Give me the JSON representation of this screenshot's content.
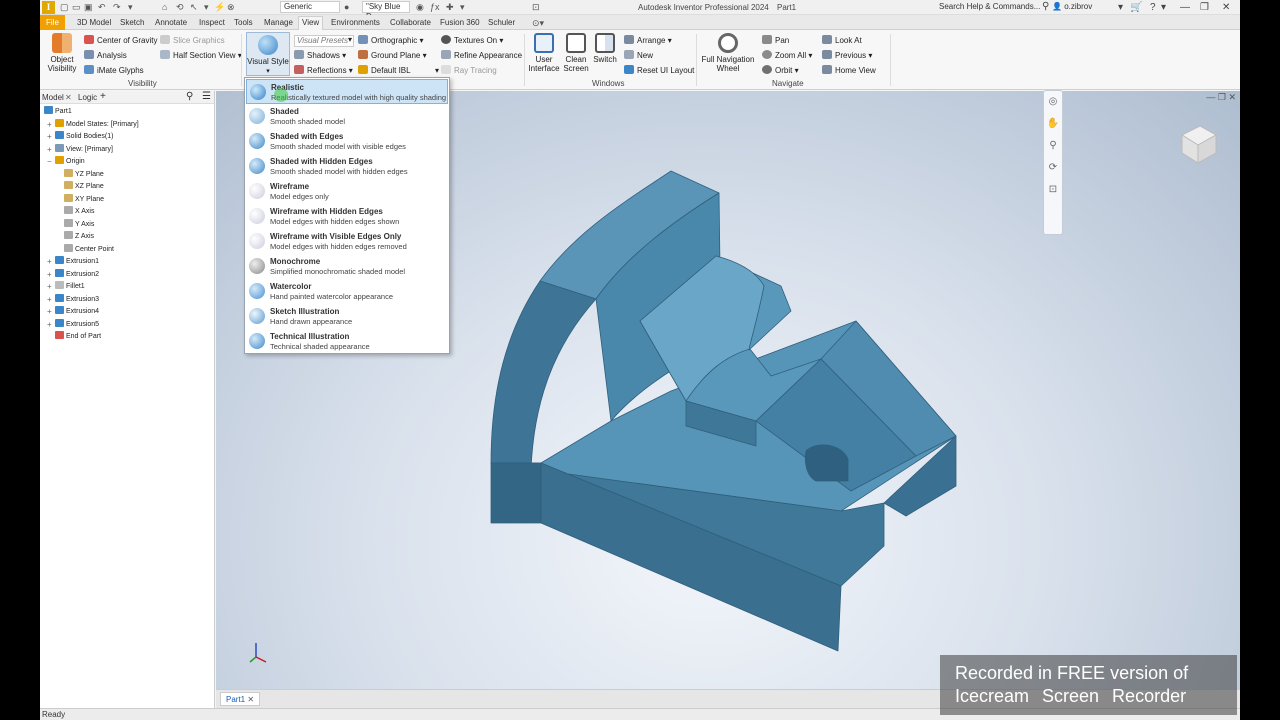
{
  "titlebar": {
    "app_title": "Autodesk Inventor Professional 2024",
    "doc_title": "Part1",
    "appearance": "Generic",
    "material": "\"Sky Blue D",
    "search_placeholder": "Search Help & Commands...",
    "user": "o.zibrov"
  },
  "menu_tabs": [
    "File",
    "3D Model",
    "Sketch",
    "Annotate",
    "Inspect",
    "Tools",
    "Manage",
    "View",
    "Environments",
    "Collaborate",
    "Fusion 360",
    "Schuler"
  ],
  "active_tab": "View",
  "ribbon": {
    "visibility": {
      "object_visibility": "Object\nVisibility",
      "center_of_gravity": "Center of Gravity",
      "slice_graphics": "Slice Graphics",
      "analysis": "Analysis",
      "half_section_view": "Half Section View",
      "imate_glyphs": "iMate Glyphs",
      "label": "Visibility"
    },
    "appearance": {
      "visual_style": "Visual Style",
      "visual_presets": "Visual Presets",
      "shadows": "Shadows",
      "reflections": "Reflections",
      "orthographic": "Orthographic",
      "ground_plane": "Ground Plane",
      "default_ibl": "Default IBL",
      "textures_on": "Textures On",
      "refine_appearance": "Refine Appearance",
      "ray_tracing": "Ray Tracing"
    },
    "windows": {
      "user_interface": "User\nInterface",
      "clean_screen": "Clean\nScreen",
      "switch": "Switch",
      "arrange": "Arrange",
      "new": "New",
      "reset_ui_layout": "Reset UI Layout",
      "label": "Windows"
    },
    "navigate": {
      "full_navigation_wheel": "Full Navigation\nWheel",
      "pan": "Pan",
      "zoom_all": "Zoom All",
      "orbit": "Orbit",
      "look_at": "Look At",
      "previous": "Previous",
      "home_view": "Home View",
      "label": "Navigate"
    }
  },
  "browser": {
    "tabs": [
      "Model",
      "Logic"
    ],
    "tree": [
      {
        "label": "Part1",
        "indent": 0
      },
      {
        "label": "Model States: [Primary]",
        "indent": 1
      },
      {
        "label": "Solid Bodies(1)",
        "indent": 1
      },
      {
        "label": "View: [Primary]",
        "indent": 1
      },
      {
        "label": "Origin",
        "indent": 1
      },
      {
        "label": "YZ Plane",
        "indent": 2
      },
      {
        "label": "XZ Plane",
        "indent": 2
      },
      {
        "label": "XY Plane",
        "indent": 2
      },
      {
        "label": "X Axis",
        "indent": 2
      },
      {
        "label": "Y Axis",
        "indent": 2
      },
      {
        "label": "Z Axis",
        "indent": 2
      },
      {
        "label": "Center Point",
        "indent": 2
      },
      {
        "label": "Extrusion1",
        "indent": 1
      },
      {
        "label": "Extrusion2",
        "indent": 1
      },
      {
        "label": "Fillet1",
        "indent": 1
      },
      {
        "label": "Extrusion3",
        "indent": 1
      },
      {
        "label": "Extrusion4",
        "indent": 1
      },
      {
        "label": "Extrusion5",
        "indent": 1
      },
      {
        "label": "End of Part",
        "indent": 1
      }
    ]
  },
  "visual_styles": [
    {
      "title": "Realistic",
      "desc": "Realistically textured model with high quality shading"
    },
    {
      "title": "Shaded",
      "desc": "Smooth shaded model"
    },
    {
      "title": "Shaded with Edges",
      "desc": "Smooth shaded model with visible edges"
    },
    {
      "title": "Shaded with Hidden Edges",
      "desc": "Smooth shaded model with hidden edges"
    },
    {
      "title": "Wireframe",
      "desc": "Model edges only"
    },
    {
      "title": "Wireframe with Hidden Edges",
      "desc": "Model edges with hidden edges shown"
    },
    {
      "title": "Wireframe with Visible Edges Only",
      "desc": "Model edges with hidden edges removed"
    },
    {
      "title": "Monochrome",
      "desc": "Simplified monochromatic shaded model"
    },
    {
      "title": "Watercolor",
      "desc": "Hand painted watercolor appearance"
    },
    {
      "title": "Sketch Illustration",
      "desc": "Hand drawn appearance"
    },
    {
      "title": "Technical Illustration",
      "desc": "Technical shaded appearance"
    }
  ],
  "doc_tab": "Part1",
  "status": "Ready",
  "watermark": {
    "line1": "Recorded in FREE version of",
    "line2": "Icecream Screen Recorder"
  },
  "colors": {
    "part": "#4a86a8",
    "accent": "#f0a000",
    "selection": "#cde4f7"
  }
}
